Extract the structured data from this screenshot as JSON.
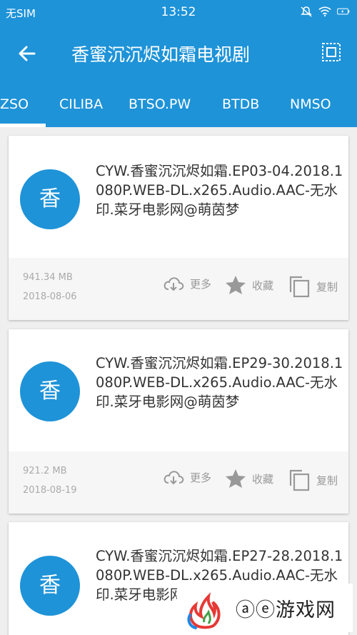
{
  "status_bar": {
    "carrier": "无SIM",
    "time": "13:52"
  },
  "app_bar": {
    "title": "香蜜沉沉烬如霜电视剧"
  },
  "tabs": [
    "ZSO",
    "CILIBA",
    "BTSO.PW",
    "BTDB",
    "NMSO"
  ],
  "actions": {
    "more": "更多",
    "favorite": "收藏",
    "copy": "复制"
  },
  "results": [
    {
      "avatar": "香",
      "name": "CYW.香蜜沉沉烬如霜.EP03-04.2018.1080P.WEB-DL.x265.Audio.AAC-无水印.菜牙电影网@萌茵梦",
      "size": "941.34 MB",
      "date": "2018-08-06"
    },
    {
      "avatar": "香",
      "name": "CYW.香蜜沉沉烬如霜.EP29-30.2018.1080P.WEB-DL.x265.Audio.AAC-无水印.菜牙电影网@萌茵梦",
      "size": "921.2 MB",
      "date": "2018-08-19"
    },
    {
      "avatar": "香",
      "name": "CYW.香蜜沉沉烬如霜.EP27-28.2018.1080P.WEB-DL.x265.Audio.AAC-无水印.菜牙电影网@萌茵梦"
    }
  ],
  "watermark": {
    "text": "ⓐⓔ游戏网"
  },
  "colors": {
    "primary": "#1e93d8",
    "card_footer": "#f6f6f6"
  }
}
